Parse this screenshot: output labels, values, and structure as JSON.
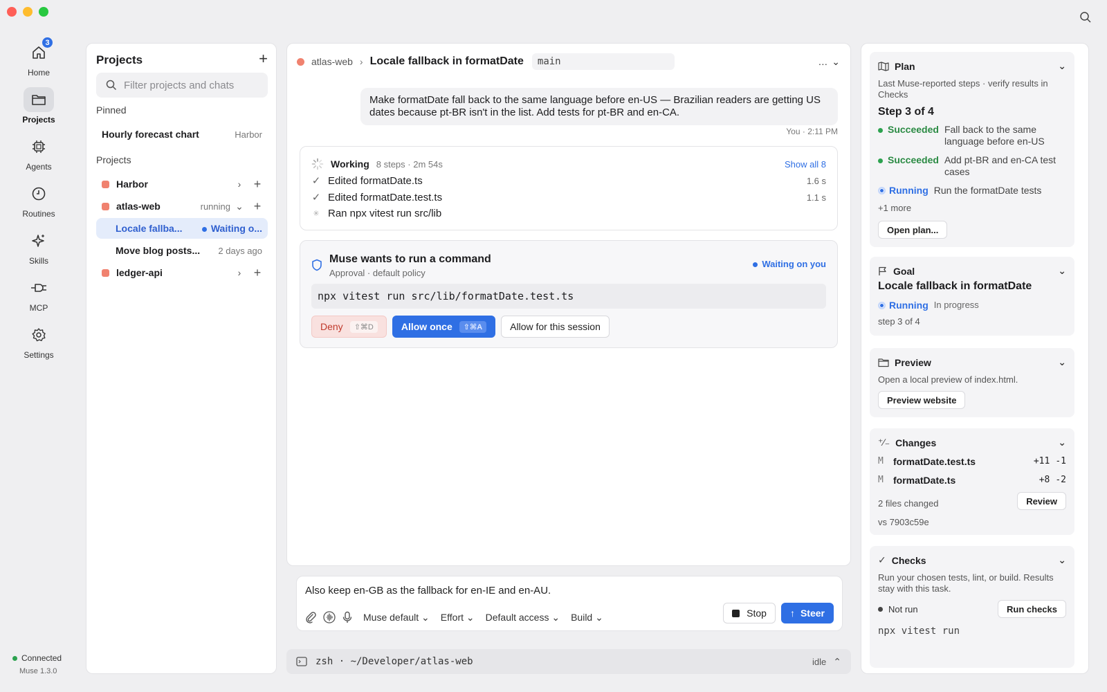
{
  "rail": {
    "items": [
      {
        "label": "Home",
        "icon": "home-icon"
      },
      {
        "label": "Projects",
        "icon": "folder-icon"
      },
      {
        "label": "Agents",
        "icon": "chip-icon"
      },
      {
        "label": "Routines",
        "icon": "clock-icon"
      },
      {
        "label": "Skills",
        "icon": "sparkle-icon"
      },
      {
        "label": "MCP",
        "icon": "plug-icon"
      },
      {
        "label": "Settings",
        "icon": "gear-icon"
      }
    ],
    "home_badge": "3",
    "status": "Connected",
    "version": "Muse 1.3.0"
  },
  "projects": {
    "title": "Projects",
    "filter_placeholder": "Filter projects and chats",
    "pinned_label": "Pinned",
    "pinned": [
      {
        "name": "Hourly forecast chart",
        "meta": "Harbor"
      }
    ],
    "section_label": "Projects",
    "items": [
      {
        "name": "Harbor"
      },
      {
        "name": "atlas-web",
        "meta": "running"
      },
      {
        "name": "Locale fallba...",
        "meta": "Waiting o..."
      },
      {
        "name": "Move blog posts...",
        "meta": "2 days ago"
      },
      {
        "name": "ledger-api"
      }
    ]
  },
  "main": {
    "crumb": "atlas-web",
    "title": "Locale fallback in formatDate",
    "branch": "main",
    "more": "…",
    "user_message": "Make formatDate fall back to the same language before en-US — Brazilian readers are getting US dates because pt-BR isn't in the list. Add tests for pt-BR and en-CA.",
    "user_meta": "You · 2:11 PM",
    "working": {
      "title": "Working",
      "meta": "8 steps · 2m 54s",
      "show_all": "Show all 8",
      "steps": [
        {
          "text": "Edited formatDate.ts",
          "dur": "1.6 s"
        },
        {
          "text": "Edited formatDate.test.ts",
          "dur": "1.1 s"
        },
        {
          "text": "Ran npx vitest run src/lib",
          "dur": ""
        }
      ]
    },
    "approval": {
      "title": "Muse wants to run a command",
      "subtitle": "Approval · default policy",
      "status": "Waiting on you",
      "command": "npx vitest run src/lib/formatDate.test.ts",
      "deny": "Deny",
      "deny_kbd": "⇧⌘D",
      "allow_once": "Allow once",
      "allow_kbd": "⇧⌘A",
      "allow_session": "Allow for this session"
    }
  },
  "composer": {
    "text": "Also keep en-GB as the fallback for en-IE and en-AU.",
    "model": "Muse default",
    "effort": "Effort",
    "access": "Default access",
    "mode": "Build",
    "stop": "Stop",
    "steer": "Steer"
  },
  "terminal": {
    "label": "zsh · ~/Developer/atlas-web",
    "status": "idle"
  },
  "right": {
    "plan": {
      "title": "Plan",
      "desc": "Last Muse-reported steps · verify results in Checks",
      "step": "Step 3 of 4",
      "items": [
        {
          "status": "Succeeded",
          "text": "Fall back to the same language before en-US"
        },
        {
          "status": "Succeeded",
          "text": "Add pt-BR and en-CA test cases"
        },
        {
          "status": "Running",
          "text": "Run the formatDate tests"
        }
      ],
      "more": "+1 more",
      "button": "Open plan..."
    },
    "goal": {
      "title": "Goal",
      "name": "Locale fallback in formatDate",
      "status": "Running",
      "status_meta": "In progress",
      "step": "step 3 of 4"
    },
    "preview": {
      "title": "Preview",
      "desc": "Open a local preview of index.html.",
      "button": "Preview website"
    },
    "changes": {
      "title": "Changes",
      "files": [
        {
          "mark": "M",
          "name": "formatDate.test.ts",
          "add": "+11",
          "del": "-1"
        },
        {
          "mark": "M",
          "name": "formatDate.ts",
          "add": "+8",
          "del": "-2"
        }
      ],
      "summary": "2 files changed",
      "vs": "vs 7903c59e",
      "button": "Review"
    },
    "checks": {
      "title": "Checks",
      "desc": "Run your chosen tests, lint, or build. Results stay with this task.",
      "status": "Not run",
      "button": "Run checks",
      "command": "npx vitest run"
    }
  },
  "colors": {
    "accent": "#2f6fe4",
    "success": "#2a8a43",
    "project_dot": "#f0826f",
    "deny": "#c0392b"
  }
}
